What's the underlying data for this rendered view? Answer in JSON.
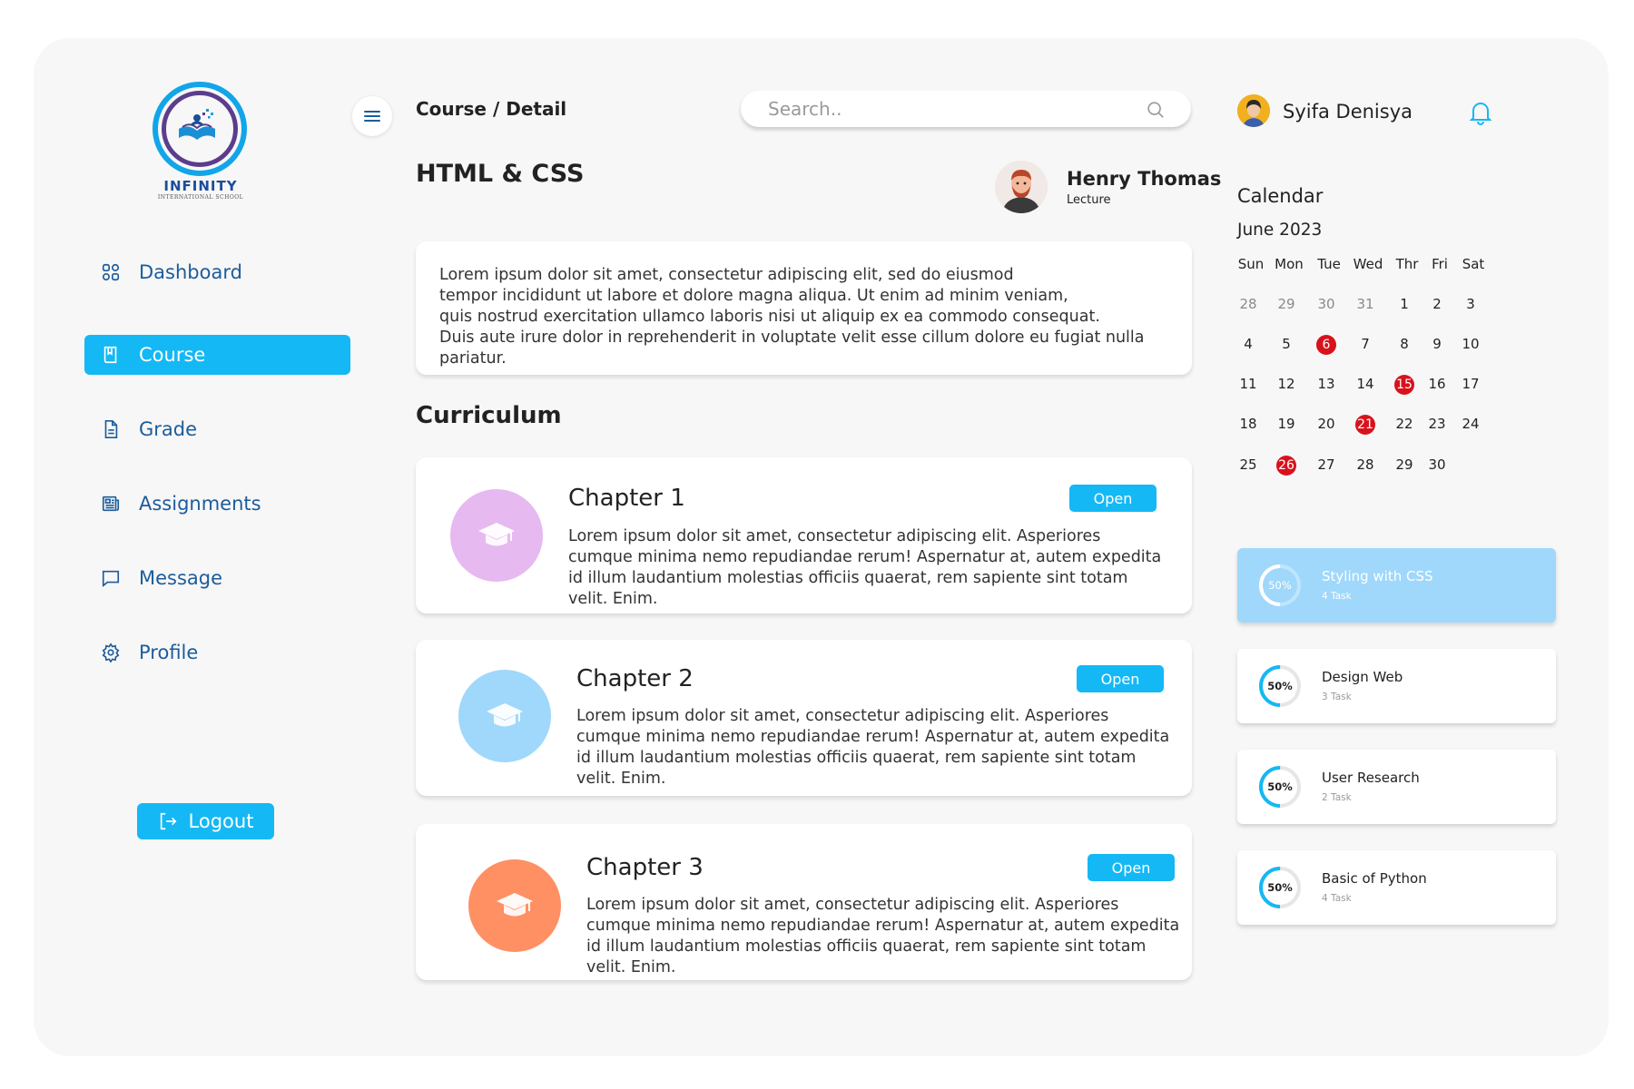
{
  "brand": {
    "name": "INFINITY",
    "tagline": "INTERNATIONAL SCHOOL"
  },
  "sidebar": {
    "items": [
      {
        "label": "Dashboard",
        "icon": "dashboard-grid-icon",
        "active": false
      },
      {
        "label": "Course",
        "icon": "book-icon",
        "active": true
      },
      {
        "label": "Grade",
        "icon": "document-icon",
        "active": false
      },
      {
        "label": "Assignments",
        "icon": "newspaper-icon",
        "active": false
      },
      {
        "label": "Message",
        "icon": "chat-bubble-icon",
        "active": false
      },
      {
        "label": "Profile",
        "icon": "gear-icon",
        "active": false
      }
    ],
    "logout_label": "Logout"
  },
  "header": {
    "breadcrumb": "Course / Detail",
    "search_placeholder": "Search..",
    "user_name": "Syifa Denisya"
  },
  "course": {
    "title": "HTML & CSS",
    "lecturer_name": "Henry Thomas",
    "lecturer_role": "Lecture",
    "description": "Lorem ipsum dolor sit amet, consectetur adipiscing elit, sed do eiusmod\ntempor incididunt ut labore et dolore magna aliqua. Ut enim ad minim veniam,\nquis nostrud exercitation ullamco laboris nisi ut aliquip ex ea commodo consequat.\nDuis aute irure dolor in reprehenderit in voluptate velit esse cillum dolore eu fugiat nulla pariatur."
  },
  "curriculum": {
    "title": "Curriculum",
    "chapters": [
      {
        "title": "Chapter 1",
        "body": "Lorem ipsum dolor sit amet, consectetur adipiscing elit. Asperiores cumque minima nemo repudiandae rerum! Aspernatur at, autem expedita id illum laudantium molestias officiis quaerat, rem sapiente sint totam velit. Enim.",
        "button": "Open",
        "icon_color": "#e6b9f0"
      },
      {
        "title": "Chapter 2",
        "body": "Lorem ipsum dolor sit amet, consectetur adipiscing elit. Asperiores cumque minima nemo repudiandae rerum! Aspernatur at, autem expedita id illum laudantium molestias officiis quaerat, rem sapiente sint totam velit. Enim.",
        "button": "Open",
        "icon_color": "#9fd8fb"
      },
      {
        "title": "Chapter 3",
        "body": "Lorem ipsum dolor sit amet, consectetur adipiscing elit. Asperiores cumque minima nemo repudiandae rerum! Aspernatur at, autem expedita id illum laudantium molestias officiis quaerat, rem sapiente sint totam velit. Enim.",
        "button": "Open",
        "icon_color": "#ff9063"
      }
    ]
  },
  "calendar": {
    "title": "Calendar",
    "month": "June 2023",
    "weekdays": [
      "Sun",
      "Mon",
      "Tue",
      "Wed",
      "Thr",
      "Fri",
      "Sat"
    ],
    "weeks": [
      [
        {
          "d": "28",
          "m": true
        },
        {
          "d": "29",
          "m": true
        },
        {
          "d": "30",
          "m": true
        },
        {
          "d": "31",
          "m": true
        },
        {
          "d": "1"
        },
        {
          "d": "2"
        },
        {
          "d": "3"
        }
      ],
      [
        {
          "d": "4"
        },
        {
          "d": "5"
        },
        {
          "d": "6",
          "h": true
        },
        {
          "d": "7"
        },
        {
          "d": "8"
        },
        {
          "d": "9"
        },
        {
          "d": "10"
        }
      ],
      [
        {
          "d": "11"
        },
        {
          "d": "12"
        },
        {
          "d": "13"
        },
        {
          "d": "14"
        },
        {
          "d": "15",
          "h": true
        },
        {
          "d": "16"
        },
        {
          "d": "17"
        }
      ],
      [
        {
          "d": "18"
        },
        {
          "d": "19"
        },
        {
          "d": "20"
        },
        {
          "d": "21",
          "h": true
        },
        {
          "d": "22"
        },
        {
          "d": "23"
        },
        {
          "d": "24"
        }
      ],
      [
        {
          "d": "25"
        },
        {
          "d": "26",
          "h": true
        },
        {
          "d": "27"
        },
        {
          "d": "28"
        },
        {
          "d": "29"
        },
        {
          "d": "30"
        }
      ]
    ],
    "highlight_color": "#d8121c"
  },
  "tasks": [
    {
      "name": "Styling with CSS",
      "count": "4 Task",
      "progress_label": "50%",
      "progress": 0.5,
      "active": true
    },
    {
      "name": "Design Web",
      "count": "3 Task",
      "progress_label": "50%",
      "progress": 0.5,
      "active": false
    },
    {
      "name": "User Research",
      "count": "2 Task",
      "progress_label": "50%",
      "progress": 0.5,
      "active": false
    },
    {
      "name": "Basic of Python",
      "count": "4 Task",
      "progress_label": "50%",
      "progress": 0.5,
      "active": false
    }
  ],
  "colors": {
    "accent": "#14b8f5",
    "nav_text": "#1c5c9c",
    "shell_bg": "#f7f7f7"
  }
}
